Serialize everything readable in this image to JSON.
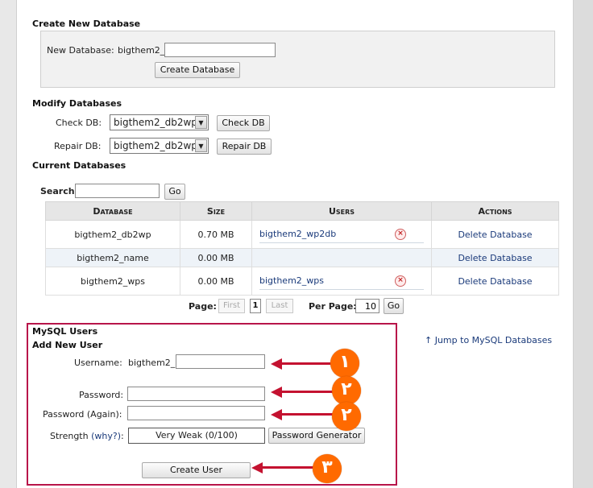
{
  "create_db": {
    "heading": "Create New Database",
    "new_db_label": "New Database:",
    "prefix": "bigthem2_",
    "input_value": "",
    "button": "Create Database"
  },
  "modify_db": {
    "heading": "Modify Databases",
    "check_label": "Check DB:",
    "check_selected": "bigthem2_db2wp",
    "check_button": "Check DB",
    "repair_label": "Repair DB:",
    "repair_selected": "bigthem2_db2wp",
    "repair_button": "Repair DB"
  },
  "current_db": {
    "heading": "Current Databases",
    "search_label": "Search",
    "search_value": "",
    "go_button": "Go",
    "columns": [
      "Database",
      "Size",
      "Users",
      "Actions"
    ],
    "rows": [
      {
        "database": "bigthem2_db2wp",
        "size": "0.70 MB",
        "user": "bigthem2_wp2db",
        "action": "Delete Database"
      },
      {
        "database": "bigthem2_name",
        "size": "0.00 MB",
        "user": "",
        "action": "Delete Database"
      },
      {
        "database": "bigthem2_wps",
        "size": "0.00 MB",
        "user": "bigthem2_wps",
        "action": "Delete Database"
      }
    ]
  },
  "pagination": {
    "page_label": "Page:",
    "first": "First",
    "current": "1",
    "last": "Last",
    "per_page_label": "Per Page:",
    "per_page_value": "10",
    "go_button": "Go"
  },
  "mysql_users": {
    "heading": "MySQL Users",
    "subheading": "Add New User",
    "username_label": "Username:",
    "username_prefix": "bigthem2_",
    "username_value": "",
    "password_label": "Password:",
    "password_again_label": "Password (Again):",
    "strength_label": "Strength",
    "why_link": "(why?)",
    "strength_colon": ":",
    "strength_value": "Very Weak (0/100)",
    "generator_button": "Password Generator",
    "create_button": "Create User",
    "jump_link": "Jump to MySQL Databases"
  },
  "annotations": {
    "step1": "١",
    "step2": "٢",
    "step3": "٣",
    "color": "#c41230",
    "badge_color": "#ff6a00"
  }
}
